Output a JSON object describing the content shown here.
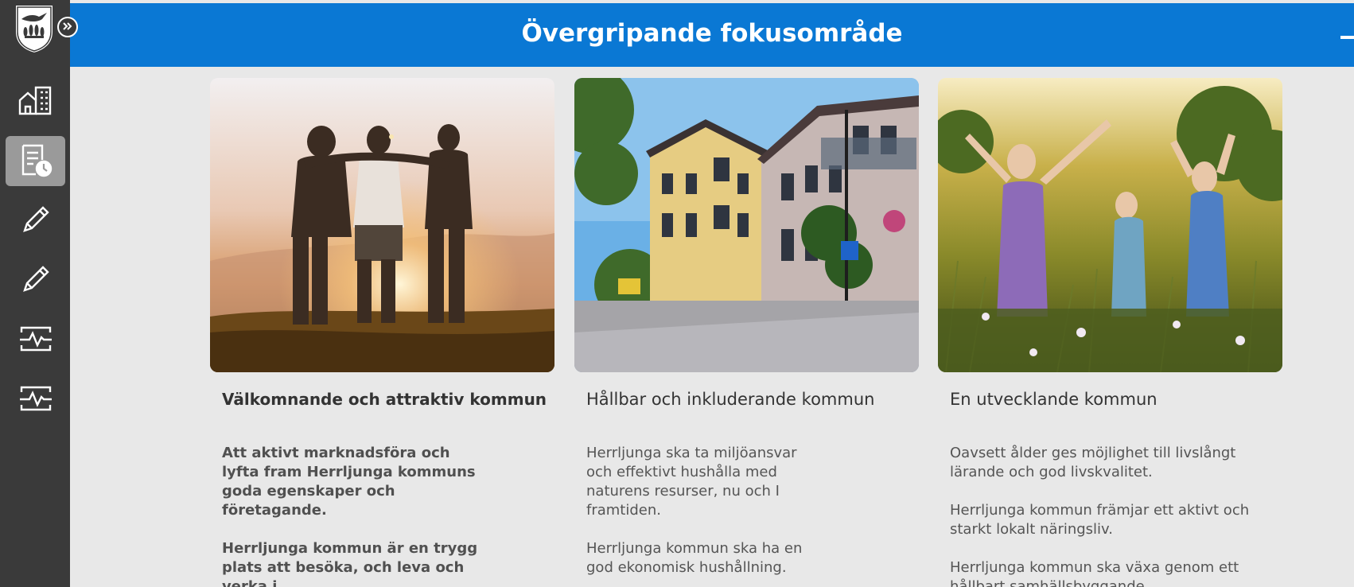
{
  "header": {
    "title": "Övergripande fokusområde",
    "add_icon": "plus-icon",
    "background": "#0a78d4"
  },
  "sidebar": {
    "logo": "coat-of-arms-logo",
    "expand_icon": "double-chevron-right-icon",
    "items": [
      {
        "icon": "building-icon",
        "active": false
      },
      {
        "icon": "report-clock-icon",
        "active": true
      },
      {
        "icon": "pen-icon",
        "active": false
      },
      {
        "icon": "pen-icon",
        "active": false
      },
      {
        "icon": "chart-pulse-icon",
        "active": false
      },
      {
        "icon": "chart-pulse-icon",
        "active": false
      }
    ]
  },
  "cards": [
    {
      "title": "Välkomnande och attraktiv kommun",
      "image": "friends-sunset-photo",
      "paragraphs": [
        "Att aktivt marknadsföra och\nlyfta fram Herrljunga kommuns\ngoda egenskaper och\nföretagande.",
        "Herrljunga kommun är en trygg\nplats att besöka, och leva och\nverka i."
      ]
    },
    {
      "title": "Hållbar och inkluderande kommun",
      "image": "town-street-photo",
      "paragraphs": [
        "Herrljunga ska ta miljöansvar\noch effektivt hushålla med\nnaturens resurser, nu och I\nframtiden.",
        "Herrljunga kommun ska ha en\ngod ekonomisk hushållning."
      ]
    },
    {
      "title": "En utvecklande kommun",
      "image": "girls-meadow-photo",
      "paragraphs": [
        "Oavsett ålder ges möjlighet till livslångt\nlärande och god livskvalitet.",
        "Herrljunga kommun främjar ett aktivt och\nstarkt lokalt näringsliv.",
        "Herrljunga kommun ska växa genom ett\nhållbart samhällsbyggande."
      ]
    }
  ]
}
